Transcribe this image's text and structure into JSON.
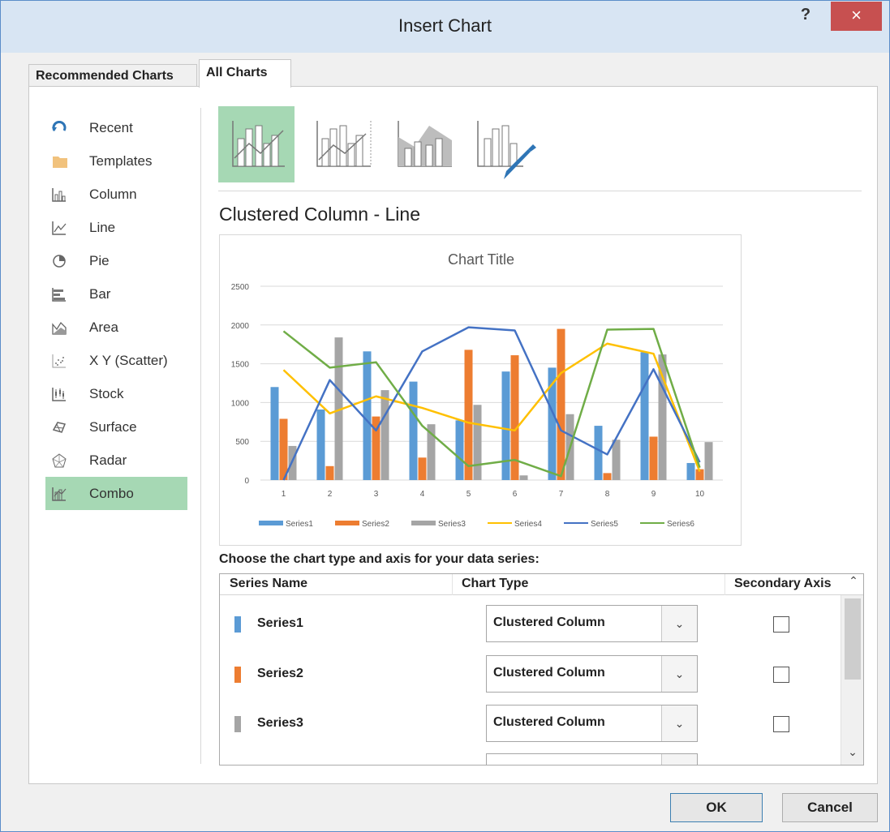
{
  "window": {
    "title": "Insert Chart",
    "help_label": "?",
    "close_label": "×"
  },
  "tabs": [
    {
      "label": "Recommended Charts"
    },
    {
      "label": "All Charts"
    }
  ],
  "sidebar": {
    "items": [
      {
        "label": "Recent",
        "icon": "recent-icon"
      },
      {
        "label": "Templates",
        "icon": "folder-icon"
      },
      {
        "label": "Column",
        "icon": "column-chart-icon"
      },
      {
        "label": "Line",
        "icon": "line-chart-icon"
      },
      {
        "label": "Pie",
        "icon": "pie-chart-icon"
      },
      {
        "label": "Bar",
        "icon": "bar-chart-icon"
      },
      {
        "label": "Area",
        "icon": "area-chart-icon"
      },
      {
        "label": "X Y (Scatter)",
        "icon": "scatter-chart-icon"
      },
      {
        "label": "Stock",
        "icon": "stock-chart-icon"
      },
      {
        "label": "Surface",
        "icon": "surface-chart-icon"
      },
      {
        "label": "Radar",
        "icon": "radar-chart-icon"
      },
      {
        "label": "Combo",
        "icon": "combo-chart-icon",
        "selected": true
      }
    ]
  },
  "subtypes": [
    {
      "icon": "clustered-column-line-icon",
      "selected": true
    },
    {
      "icon": "clustered-column-line-secondary-axis-icon"
    },
    {
      "icon": "stacked-area-clustered-column-icon"
    },
    {
      "icon": "custom-combination-icon"
    }
  ],
  "selected_subtype_name": "Clustered Column - Line",
  "chart_data": {
    "type": "bar",
    "title": "Chart Title",
    "categories": [
      "1",
      "2",
      "3",
      "4",
      "5",
      "6",
      "7",
      "8",
      "9",
      "10"
    ],
    "ylim": [
      0,
      2500
    ],
    "yticks": [
      "0",
      "500",
      "1000",
      "1500",
      "2000",
      "2500"
    ],
    "grid": true,
    "legend_position": "bottom",
    "series": [
      {
        "name": "Series1",
        "kind": "column",
        "color": "#5b9bd5",
        "values": [
          1200,
          910,
          1660,
          1270,
          770,
          1400,
          1450,
          700,
          1650,
          220
        ]
      },
      {
        "name": "Series2",
        "kind": "column",
        "color": "#ed7d31",
        "values": [
          790,
          180,
          820,
          290,
          1680,
          1610,
          1950,
          90,
          560,
          140
        ]
      },
      {
        "name": "Series3",
        "kind": "column",
        "color": "#a5a5a5",
        "values": [
          440,
          1840,
          1160,
          720,
          970,
          60,
          850,
          520,
          1620,
          490
        ]
      },
      {
        "name": "Series4",
        "kind": "line",
        "color": "#ffc000",
        "values": [
          1420,
          860,
          1080,
          930,
          740,
          640,
          1380,
          1760,
          1630,
          110
        ]
      },
      {
        "name": "Series5",
        "kind": "line",
        "color": "#4472c4",
        "values": [
          0,
          1290,
          640,
          1660,
          1970,
          1930,
          640,
          330,
          1430,
          230
        ]
      },
      {
        "name": "Series6",
        "kind": "line",
        "color": "#70ad47",
        "values": [
          1920,
          1450,
          1520,
          700,
          180,
          260,
          50,
          1940,
          1950,
          160
        ]
      }
    ]
  },
  "series_table": {
    "prompt": "Choose the chart type and axis for your data series:",
    "headers": {
      "name": "Series Name",
      "type": "Chart Type",
      "secondary": "Secondary Axis"
    },
    "rows": [
      {
        "name": "Series1",
        "color": "#5b9bd5",
        "chart_type": "Clustered Column",
        "secondary": false
      },
      {
        "name": "Series2",
        "color": "#ed7d31",
        "chart_type": "Clustered Column",
        "secondary": false
      },
      {
        "name": "Series3",
        "color": "#a5a5a5",
        "chart_type": "Clustered Column",
        "secondary": false
      },
      {
        "name": "",
        "color": "#ffc000",
        "chart_type": "",
        "secondary": false
      }
    ]
  },
  "buttons": {
    "ok": "OK",
    "cancel": "Cancel"
  }
}
